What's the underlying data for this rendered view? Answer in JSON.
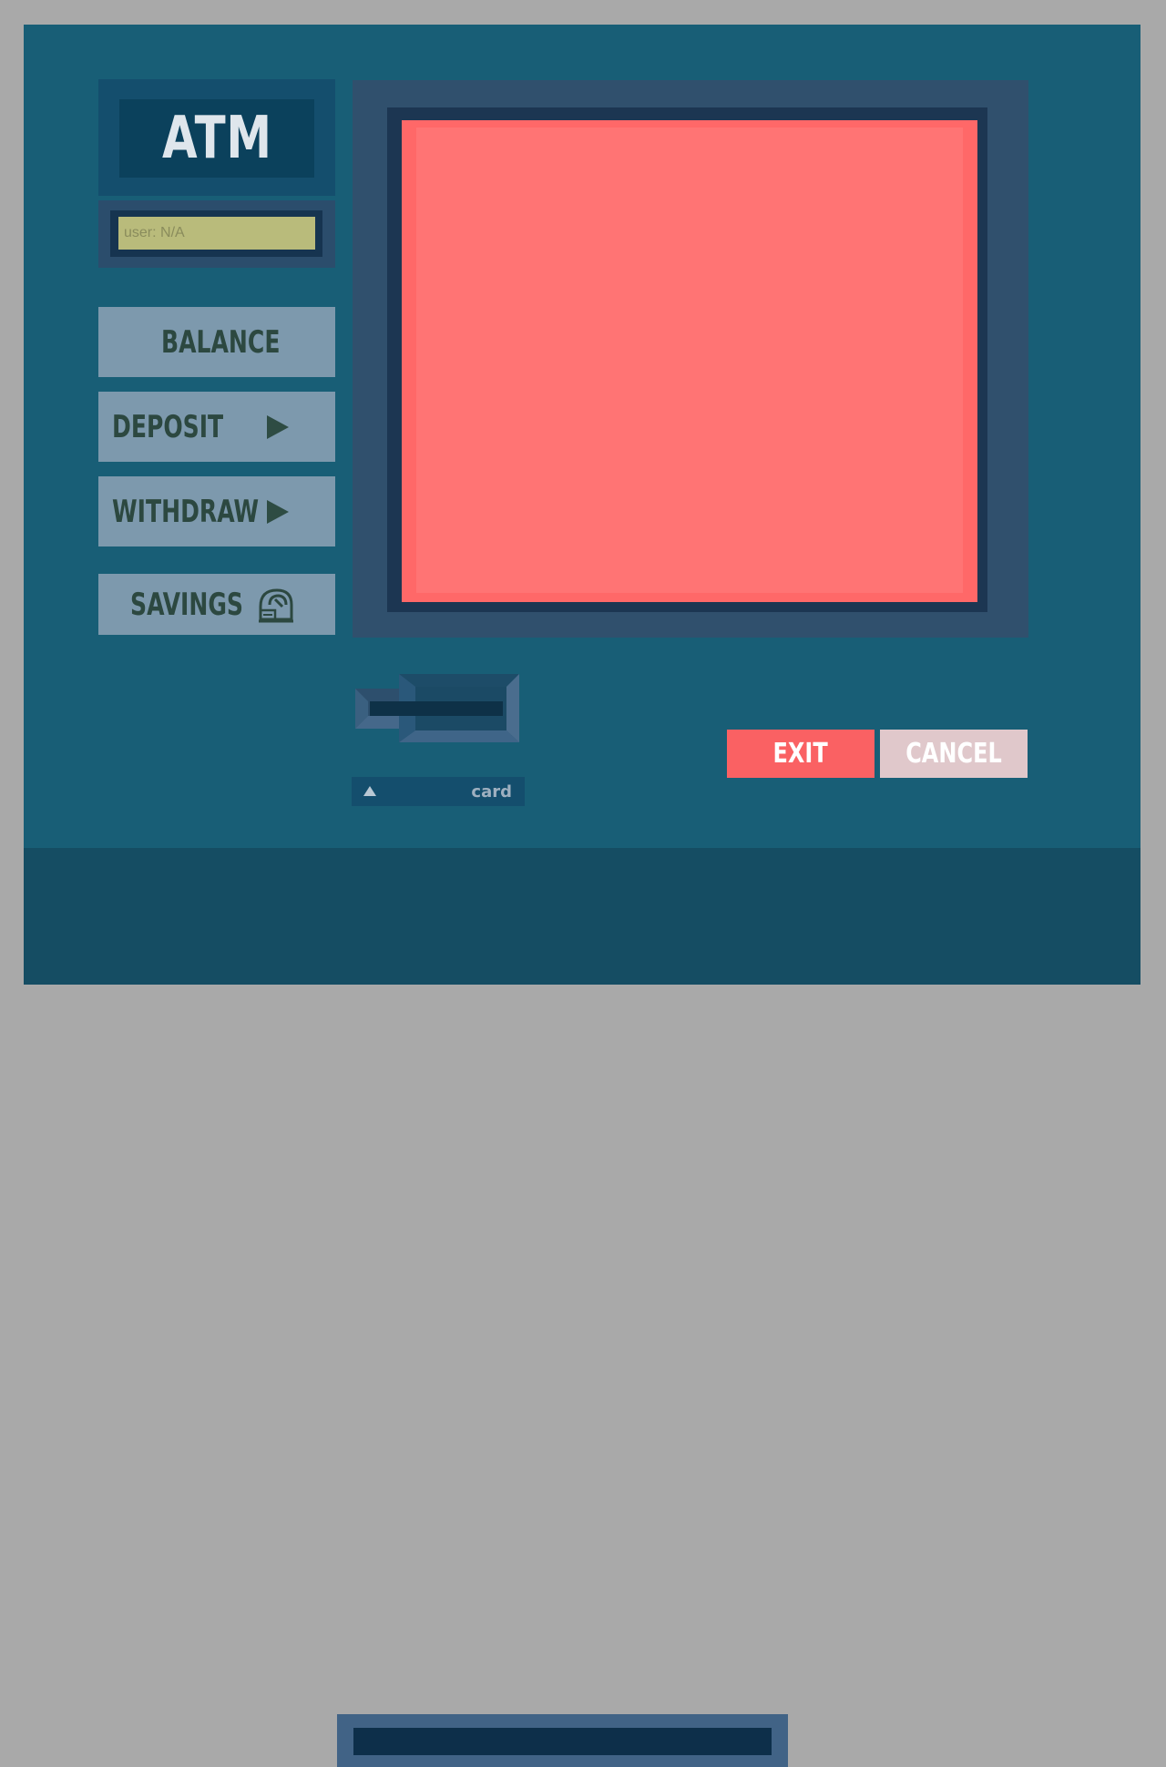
{
  "logo": {
    "text": "ATM"
  },
  "user": {
    "display": "user: N/A"
  },
  "menu": {
    "balance": "BALANCE",
    "deposit": "DEPOSIT",
    "withdraw": "WITHDRAW",
    "savings": "SAVINGS"
  },
  "card_slot": {
    "label": "card",
    "icon": "triangle-up-icon"
  },
  "actions": {
    "exit": "EXIT",
    "cancel": "CANCEL"
  },
  "icons": {
    "deposit": "play-arrow-icon",
    "withdraw": "play-arrow-icon",
    "savings": "safe-icon"
  },
  "colors": {
    "body": "#185e76",
    "screen": "#ff7474",
    "menu_button": "#7d99ad",
    "exit_button": "#fa6163",
    "cancel_button": "#e0c8cb",
    "user_display": "#b9bb7b"
  }
}
